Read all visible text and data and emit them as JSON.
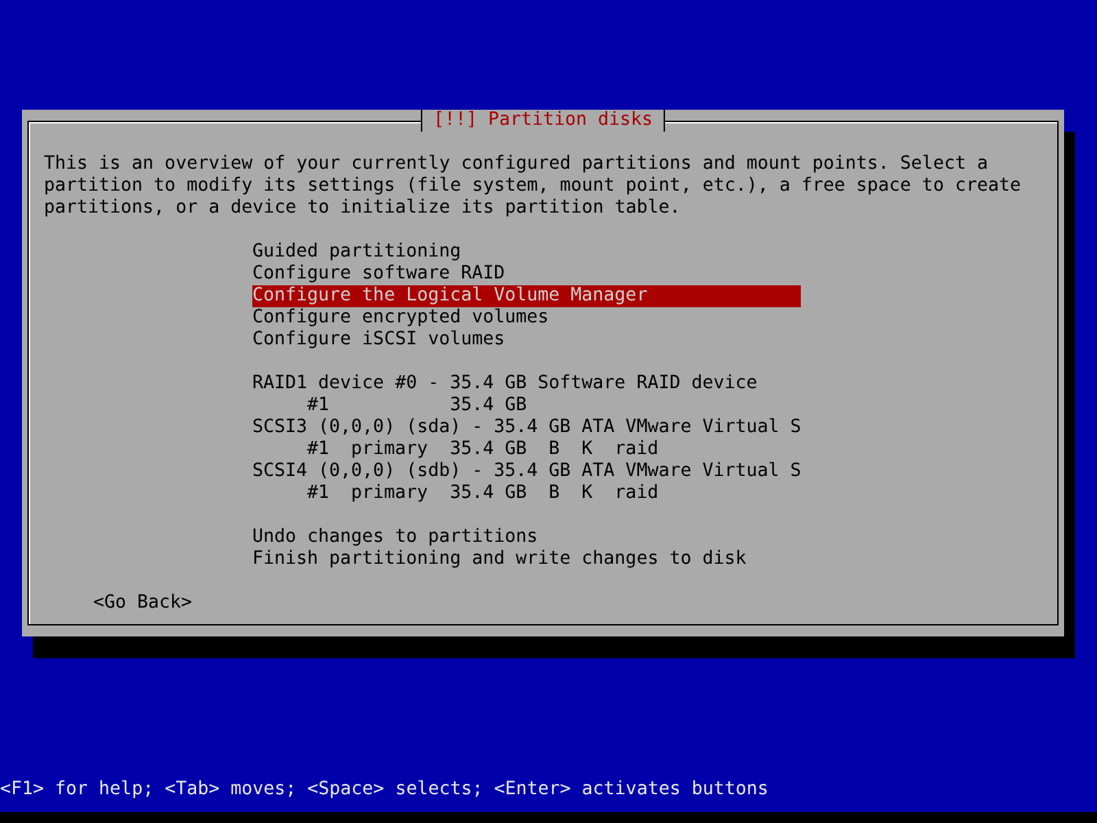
{
  "dialog": {
    "title": "[!!] Partition disks",
    "description": "This is an overview of your currently configured partitions and mount points. Select a\npartition to modify its settings (file system, mount point, etc.), a free space to create\npartitions, or a device to initialize its partition table.",
    "menu_groups": [
      [
        {
          "text": "Guided partitioning",
          "selected": false
        },
        {
          "text": "Configure software RAID",
          "selected": false
        },
        {
          "text": "Configure the Logical Volume Manager",
          "selected": true
        },
        {
          "text": "Configure encrypted volumes",
          "selected": false
        },
        {
          "text": "Configure iSCSI volumes",
          "selected": false
        }
      ],
      [
        {
          "text": "RAID1 device #0 - 35.4 GB Software RAID device",
          "selected": false,
          "children": [
            {
              "text": "#1           35.4 GB",
              "selected": false
            }
          ]
        },
        {
          "text": "SCSI3 (0,0,0) (sda) - 35.4 GB ATA VMware Virtual S",
          "selected": false,
          "children": [
            {
              "text": "#1  primary  35.4 GB  B  K  raid",
              "selected": false
            }
          ]
        },
        {
          "text": "SCSI4 (0,0,0) (sdb) - 35.4 GB ATA VMware Virtual S",
          "selected": false,
          "children": [
            {
              "text": "#1  primary  35.4 GB  B  K  raid",
              "selected": false
            }
          ]
        }
      ],
      [
        {
          "text": "Undo changes to partitions",
          "selected": false
        },
        {
          "text": "Finish partitioning and write changes to disk",
          "selected": false
        }
      ]
    ],
    "back_button": "<Go Back>"
  },
  "help_line": "<F1> for help; <Tab> moves; <Space> selects; <Enter> activates buttons"
}
